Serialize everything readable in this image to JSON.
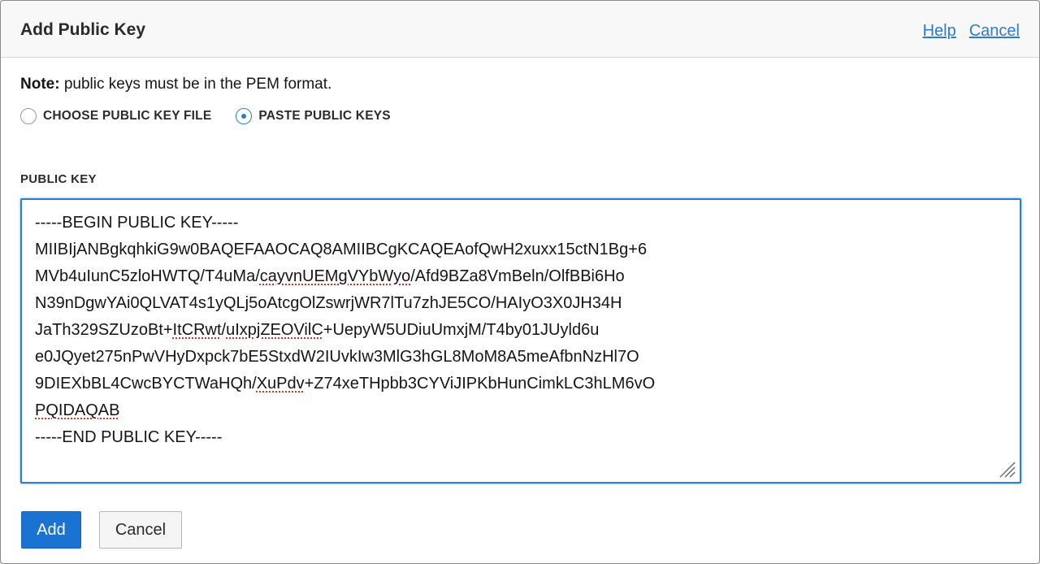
{
  "dialog": {
    "title": "Add Public Key",
    "help_link": "Help",
    "cancel_link": "Cancel"
  },
  "note": {
    "bold": "Note:",
    "text": " public keys must be in the PEM format."
  },
  "radio_options": [
    {
      "label": "CHOOSE PUBLIC KEY FILE",
      "checked": false
    },
    {
      "label": "PASTE PUBLIC KEYS",
      "checked": true
    }
  ],
  "public_key": {
    "label": "PUBLIC KEY",
    "lines": [
      [
        {
          "t": "-----BEGIN PUBLIC KEY-----"
        }
      ],
      [
        {
          "t": "MIIBIjANBgkqhkiG9w0BAQEFAAOCAQ8AMIIBCgKCAQEAofQwH2xuxx15ctN1Bg+6"
        }
      ],
      [
        {
          "t": "MVb4uIunC5zloHWTQ/T4uMa/"
        },
        {
          "t": "cayvnUEMgVYbWyo",
          "s": true
        },
        {
          "t": "/Afd9BZa8VmBeln/OlfBBi6Ho"
        }
      ],
      [
        {
          "t": "N39nDgwYAi0QLVAT4s1yQLj5oAtcgOlZswrjWR7lTu7zhJE5CO/HAIyO3X0JH34H"
        }
      ],
      [
        {
          "t": "JaTh329SZUzoBt+"
        },
        {
          "t": "ItCRwt",
          "s": true
        },
        {
          "t": "/"
        },
        {
          "t": "uIxpjZEOVilC",
          "s": true
        },
        {
          "t": "+UepyW5UDiuUmxjM/T4by01JUyld6u"
        }
      ],
      [
        {
          "t": "e0JQyet275nPwVHyDxpck7bE5StxdW2IUvkIw3MlG3hGL8MoM8A5meAfbnNzHl7O"
        }
      ],
      [
        {
          "t": "9DIEXbBL4CwcBYCTWaHQh/"
        },
        {
          "t": "XuPdv",
          "s": true
        },
        {
          "t": "+Z74xeTHpbb3CYViJIPKbHunCimkLC3hLM6vO"
        }
      ],
      [
        {
          "t": "PQIDAQAB",
          "s": true
        }
      ],
      [
        {
          "t": "-----END PUBLIC KEY-----"
        }
      ]
    ]
  },
  "buttons": {
    "add": "Add",
    "cancel": "Cancel"
  },
  "colors": {
    "accent": "#2c7cd3",
    "primary_button": "#1a73d1",
    "spellcheck": "#d93025"
  }
}
